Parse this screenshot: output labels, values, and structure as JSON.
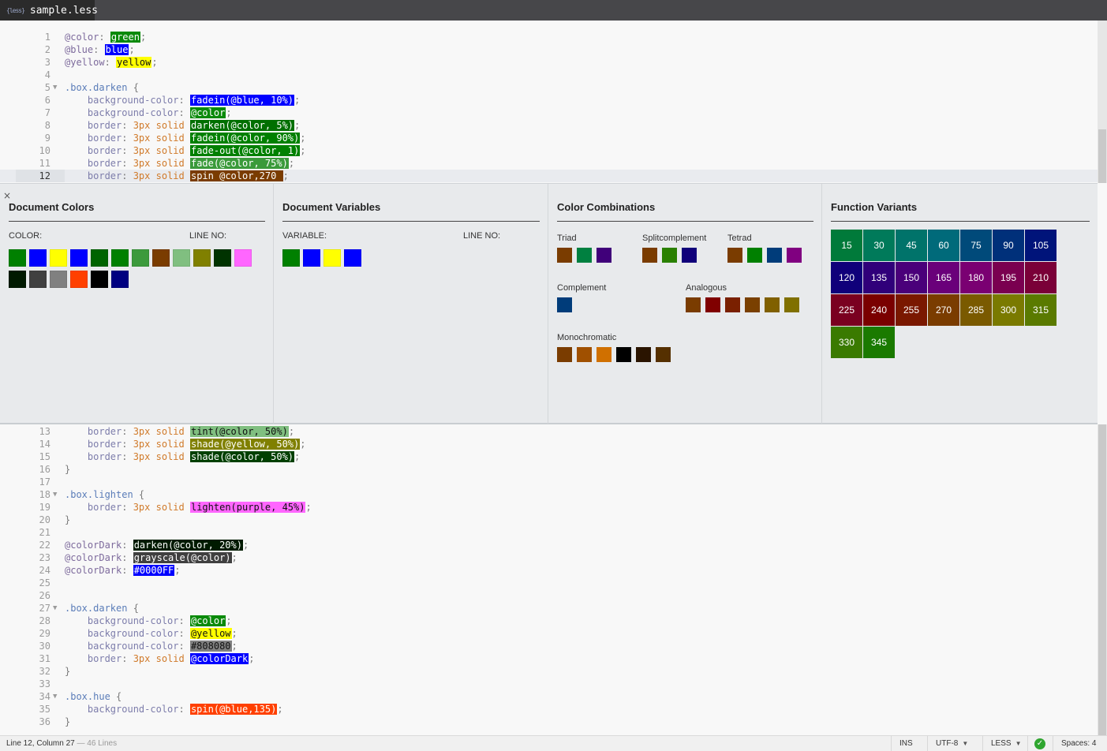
{
  "tab": {
    "icon": "{less}",
    "title": "sample.less"
  },
  "code_top": [
    {
      "n": "1",
      "parts": [
        [
          "v",
          "@color"
        ],
        [
          "p",
          ": "
        ],
        [
          "sw",
          "green",
          "#0a8a0a"
        ],
        [
          "p",
          ";"
        ]
      ]
    },
    {
      "n": "2",
      "parts": [
        [
          "v",
          "@blue"
        ],
        [
          "p",
          ": "
        ],
        [
          "sw",
          "blue",
          "#0000ff"
        ],
        [
          "p",
          ";"
        ]
      ]
    },
    {
      "n": "3",
      "parts": [
        [
          "v",
          "@yellow"
        ],
        [
          "p",
          ": "
        ],
        [
          "swd",
          "yellow",
          "#ffff00"
        ],
        [
          "p",
          ";"
        ]
      ]
    },
    {
      "n": "4",
      "parts": []
    },
    {
      "n": "5",
      "fold": true,
      "parts": [
        [
          "cls",
          ".box.darken"
        ],
        [
          "p",
          " {"
        ]
      ]
    },
    {
      "n": "6",
      "parts": [
        [
          "k",
          "    background-color"
        ],
        [
          "p",
          ": "
        ],
        [
          "sw",
          "fadein(@blue, 10%)",
          "#0000ff"
        ],
        [
          "p",
          ";"
        ]
      ]
    },
    {
      "n": "7",
      "parts": [
        [
          "k",
          "    background-color"
        ],
        [
          "p",
          ": "
        ],
        [
          "sw",
          "@color",
          "#0a8a0a"
        ],
        [
          "p",
          ";"
        ]
      ]
    },
    {
      "n": "8",
      "parts": [
        [
          "k",
          "    border"
        ],
        [
          "p",
          ": "
        ],
        [
          "n",
          "3px"
        ],
        [
          "p",
          " "
        ],
        [
          "s",
          "solid"
        ],
        [
          "p",
          " "
        ],
        [
          "sw",
          "darken(@color, 5%)",
          "#006f00"
        ],
        [
          "p",
          ";"
        ]
      ]
    },
    {
      "n": "9",
      "parts": [
        [
          "k",
          "    border"
        ],
        [
          "p",
          ": "
        ],
        [
          "n",
          "3px"
        ],
        [
          "p",
          " "
        ],
        [
          "s",
          "solid"
        ],
        [
          "p",
          " "
        ],
        [
          "sw",
          "fadein(@color, 90%)",
          "#008000"
        ],
        [
          "p",
          ";"
        ]
      ]
    },
    {
      "n": "10",
      "parts": [
        [
          "k",
          "    border"
        ],
        [
          "p",
          ": "
        ],
        [
          "n",
          "3px"
        ],
        [
          "p",
          " "
        ],
        [
          "s",
          "solid"
        ],
        [
          "p",
          " "
        ],
        [
          "sw",
          "fade-out(@color, 1)",
          "#008000"
        ],
        [
          "p",
          ";"
        ]
      ]
    },
    {
      "n": "11",
      "parts": [
        [
          "k",
          "    border"
        ],
        [
          "p",
          ": "
        ],
        [
          "n",
          "3px"
        ],
        [
          "p",
          " "
        ],
        [
          "s",
          "solid"
        ],
        [
          "p",
          " "
        ],
        [
          "sw",
          "fade(@color, 75%)",
          "#3a9a3a"
        ],
        [
          "p",
          ";"
        ]
      ]
    },
    {
      "n": "12",
      "active": true,
      "parts": [
        [
          "k",
          "    border"
        ],
        [
          "p",
          ": "
        ],
        [
          "n",
          "3px"
        ],
        [
          "p",
          " "
        ],
        [
          "s",
          "solid"
        ],
        [
          "p",
          " "
        ],
        [
          "sw",
          "spin @color,270 ",
          "#7a3c00"
        ],
        [
          "p",
          ";"
        ]
      ]
    }
  ],
  "code_bottom": [
    {
      "n": "13",
      "parts": [
        [
          "k",
          "    border"
        ],
        [
          "p",
          ": "
        ],
        [
          "n",
          "3px"
        ],
        [
          "p",
          " "
        ],
        [
          "s",
          "solid"
        ],
        [
          "p",
          " "
        ],
        [
          "swd",
          "tint(@color, 50%)",
          "#80bf80"
        ],
        [
          "p",
          ";"
        ]
      ]
    },
    {
      "n": "14",
      "parts": [
        [
          "k",
          "    border"
        ],
        [
          "p",
          ": "
        ],
        [
          "n",
          "3px"
        ],
        [
          "p",
          " "
        ],
        [
          "s",
          "solid"
        ],
        [
          "p",
          " "
        ],
        [
          "sw",
          "shade(@yellow, 50%)",
          "#808000"
        ],
        [
          "p",
          ";"
        ]
      ]
    },
    {
      "n": "15",
      "parts": [
        [
          "k",
          "    border"
        ],
        [
          "p",
          ": "
        ],
        [
          "n",
          "3px"
        ],
        [
          "p",
          " "
        ],
        [
          "s",
          "solid"
        ],
        [
          "p",
          " "
        ],
        [
          "sw",
          "shade(@color, 50%)",
          "#004000"
        ],
        [
          "p",
          ";"
        ]
      ]
    },
    {
      "n": "16",
      "parts": [
        [
          "p",
          "}"
        ]
      ]
    },
    {
      "n": "17",
      "parts": []
    },
    {
      "n": "18",
      "fold": true,
      "parts": [
        [
          "cls",
          ".box.lighten"
        ],
        [
          "p",
          " {"
        ]
      ]
    },
    {
      "n": "19",
      "parts": [
        [
          "k",
          "    border"
        ],
        [
          "p",
          ": "
        ],
        [
          "n",
          "3px"
        ],
        [
          "p",
          " "
        ],
        [
          "s",
          "solid"
        ],
        [
          "p",
          " "
        ],
        [
          "swd",
          "lighten(purple, 45%)",
          "#ff66ff"
        ],
        [
          "p",
          ";"
        ]
      ]
    },
    {
      "n": "20",
      "parts": [
        [
          "p",
          "}"
        ]
      ]
    },
    {
      "n": "21",
      "parts": []
    },
    {
      "n": "22",
      "parts": [
        [
          "v",
          "@colorDark"
        ],
        [
          "p",
          ": "
        ],
        [
          "sw",
          "darken(@color, 20%)",
          "#001a00"
        ],
        [
          "p",
          ";"
        ]
      ]
    },
    {
      "n": "23",
      "parts": [
        [
          "v",
          "@colorDark"
        ],
        [
          "p",
          ": "
        ],
        [
          "sw",
          "grayscale(@color)",
          "#404040"
        ],
        [
          "p",
          ";"
        ]
      ]
    },
    {
      "n": "24",
      "parts": [
        [
          "v",
          "@colorDark"
        ],
        [
          "p",
          ": "
        ],
        [
          "sw",
          "#0000FF",
          "#0000ff"
        ],
        [
          "p",
          ";"
        ]
      ]
    },
    {
      "n": "25",
      "parts": []
    },
    {
      "n": "26",
      "parts": []
    },
    {
      "n": "27",
      "fold": true,
      "parts": [
        [
          "cls",
          ".box.darken"
        ],
        [
          "p",
          " {"
        ]
      ]
    },
    {
      "n": "28",
      "parts": [
        [
          "k",
          "    background-color"
        ],
        [
          "p",
          ": "
        ],
        [
          "sw",
          "@color",
          "#0a8a0a"
        ],
        [
          "p",
          ";"
        ]
      ]
    },
    {
      "n": "29",
      "parts": [
        [
          "k",
          "    background-color"
        ],
        [
          "p",
          ": "
        ],
        [
          "swd",
          "@yellow",
          "#ffff00"
        ],
        [
          "p",
          ";"
        ]
      ]
    },
    {
      "n": "30",
      "parts": [
        [
          "k",
          "    background-color"
        ],
        [
          "p",
          ": "
        ],
        [
          "swd",
          "#808080",
          "#808080"
        ],
        [
          "p",
          ";"
        ]
      ]
    },
    {
      "n": "31",
      "parts": [
        [
          "k",
          "    border"
        ],
        [
          "p",
          ": "
        ],
        [
          "n",
          "3px"
        ],
        [
          "p",
          " "
        ],
        [
          "s",
          "solid"
        ],
        [
          "p",
          " "
        ],
        [
          "sw",
          "@colorDark",
          "#0000ff"
        ],
        [
          "p",
          ";"
        ]
      ]
    },
    {
      "n": "32",
      "parts": [
        [
          "p",
          "}"
        ]
      ]
    },
    {
      "n": "33",
      "parts": []
    },
    {
      "n": "34",
      "fold": true,
      "parts": [
        [
          "cls",
          ".box.hue"
        ],
        [
          "p",
          " {"
        ]
      ]
    },
    {
      "n": "35",
      "parts": [
        [
          "k",
          "    background-color"
        ],
        [
          "p",
          ": "
        ],
        [
          "sw",
          "spin(@blue,135)",
          "#ff4000"
        ],
        [
          "p",
          ";"
        ]
      ]
    },
    {
      "n": "36",
      "parts": [
        [
          "p",
          "}"
        ]
      ]
    }
  ],
  "panel": {
    "close": "×",
    "document_colors": {
      "title": "Document Colors",
      "color_label": "COLOR:",
      "line_label": "LINE NO:",
      "swatches": [
        "#008000",
        "#0000ff",
        "#ffff00",
        "#0000ff",
        "#006400",
        "#008000",
        "#3c9a3c",
        "#7a3c00",
        "#80bf80",
        "#808000",
        "#003300",
        "#ff66ff",
        "#001a00",
        "#404040",
        "#808080",
        "#ff4000",
        "#000000",
        "#000080"
      ]
    },
    "document_variables": {
      "title": "Document Variables",
      "variable_label": "VARIABLE:",
      "line_label": "LINE NO:",
      "swatches": [
        "#008000",
        "#0000ff",
        "#ffff00",
        "#0000ff"
      ]
    },
    "color_combinations": {
      "title": "Color Combinations",
      "triad": {
        "label": "Triad",
        "colors": [
          "#7a3c00",
          "#008040",
          "#40007a"
        ]
      },
      "splitcomplement": {
        "label": "Splitcomplement",
        "colors": [
          "#7a3c00",
          "#2a8000",
          "#10007a"
        ]
      },
      "tetrad": {
        "label": "Tetrad",
        "colors": [
          "#7a3c00",
          "#008000",
          "#003c7a",
          "#800080"
        ]
      },
      "complement": {
        "label": "Complement",
        "colors": [
          "#003c7a"
        ]
      },
      "analogous": {
        "label": "Analogous",
        "colors": [
          "#7a3c00",
          "#800000",
          "#7a2000",
          "#7a4000",
          "#806000",
          "#807000"
        ]
      },
      "monochromatic": {
        "label": "Monochromatic",
        "colors": [
          "#7a3c00",
          "#a05000",
          "#d07000",
          "#000000",
          "#2a1400",
          "#553000"
        ]
      }
    },
    "function_variants": {
      "title": "Function Variants",
      "items": [
        {
          "label": "15",
          "color": "#007a3a"
        },
        {
          "label": "30",
          "color": "#007a5a"
        },
        {
          "label": "45",
          "color": "#00736a"
        },
        {
          "label": "60",
          "color": "#006a7a"
        },
        {
          "label": "75",
          "color": "#004a7a"
        },
        {
          "label": "90",
          "color": "#00307a"
        },
        {
          "label": "105",
          "color": "#00147a"
        },
        {
          "label": "120",
          "color": "#10007a"
        },
        {
          "label": "135",
          "color": "#30007a"
        },
        {
          "label": "150",
          "color": "#4a007a"
        },
        {
          "label": "165",
          "color": "#6a007a"
        },
        {
          "label": "180",
          "color": "#7a0072"
        },
        {
          "label": "195",
          "color": "#7a0050"
        },
        {
          "label": "210",
          "color": "#7a0038"
        },
        {
          "label": "225",
          "color": "#7a0020"
        },
        {
          "label": "240",
          "color": "#7a0000"
        },
        {
          "label": "255",
          "color": "#7a1800"
        },
        {
          "label": "270",
          "color": "#7a3c00"
        },
        {
          "label": "285",
          "color": "#7a5a00"
        },
        {
          "label": "300",
          "color": "#7a7a00"
        },
        {
          "label": "315",
          "color": "#5a7a00"
        },
        {
          "label": "330",
          "color": "#3a7a00"
        },
        {
          "label": "345",
          "color": "#1a7a00"
        }
      ]
    }
  },
  "status": {
    "position": "Line 12, Column 27",
    "lines": "— 46 Lines",
    "mode": "INS",
    "encoding": "UTF-8",
    "language": "LESS",
    "spaces": "Spaces: 4"
  }
}
